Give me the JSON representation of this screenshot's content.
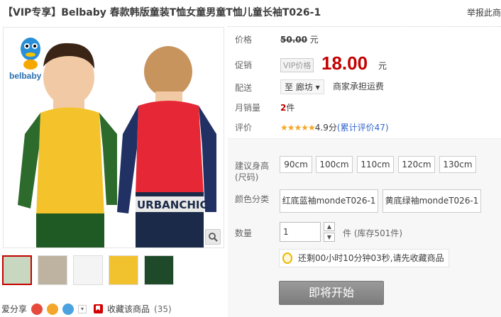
{
  "product": {
    "title": "【VIP专享】Belbaby 春款韩版童装T恤女童男童T恤儿童长袖T026-1",
    "report_link": "举报此商"
  },
  "image": {
    "brand_logo_text": "belbaby",
    "print_text": "URBANCHIC",
    "thumbnails": [
      {
        "bg": "#c8d8c0"
      },
      {
        "bg": "#bdb3a0"
      },
      {
        "bg": "#f4f4f4"
      },
      {
        "bg": "#f2c12e"
      },
      {
        "bg": "#1f4a2a"
      }
    ]
  },
  "price": {
    "label": "价格",
    "original": "50.00",
    "unit": "元"
  },
  "promo": {
    "label": "促销",
    "tag": "VIP价格",
    "price": "18.00",
    "unit": "元"
  },
  "shipping": {
    "label": "配送",
    "destination": "至 廊坊 ▾",
    "note": "商家承担运费"
  },
  "sales": {
    "label": "月销量",
    "count": "2",
    "suffix": "件"
  },
  "rating": {
    "label": "评价",
    "stars": "★★★★★",
    "score": "4.9分",
    "reviews_link": "(累计评价47)"
  },
  "size": {
    "label_line1": "建议身高",
    "label_line2": "(尺码)",
    "options": [
      "90cm",
      "100cm",
      "110cm",
      "120cm",
      "130cm"
    ]
  },
  "color": {
    "label": "颜色分类",
    "options": [
      "红底蓝袖mondeT026-1",
      "黄底绿袖mondeT026-1"
    ]
  },
  "quantity": {
    "label": "数量",
    "value": "1",
    "stock": "件 (库存501件)"
  },
  "countdown": {
    "text": "还剩00小时10分钟03秒,请先收藏商品"
  },
  "buy_button": {
    "label": "即将开始"
  },
  "share": {
    "label": "爱分享",
    "favorite_label": "收藏该商品",
    "favorite_count": "(35)"
  },
  "colors": {
    "price_red": "#c40000",
    "link_blue": "#3366cc",
    "star": "#f5a623"
  }
}
